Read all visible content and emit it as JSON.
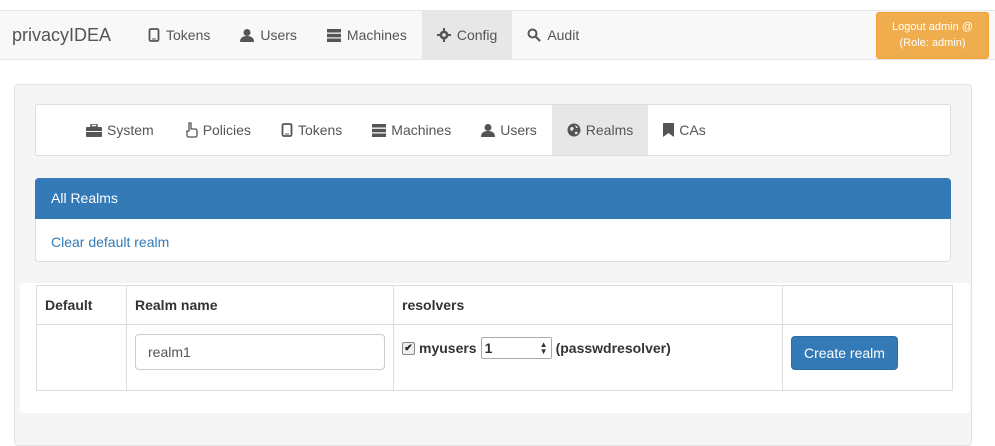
{
  "navbar": {
    "brand": "privacyIDEA",
    "items": [
      {
        "label": "Tokens",
        "icon": "phone-icon"
      },
      {
        "label": "Users",
        "icon": "user-icon"
      },
      {
        "label": "Machines",
        "icon": "server-icon"
      },
      {
        "label": "Config",
        "icon": "gear-icon",
        "active": true
      },
      {
        "label": "Audit",
        "icon": "search-icon"
      }
    ],
    "logout_line1": "Logout admin @",
    "logout_line2": "(Role: admin)"
  },
  "config_nav": {
    "items": [
      {
        "label": "System",
        "icon": "briefcase-icon"
      },
      {
        "label": "Policies",
        "icon": "hand-icon"
      },
      {
        "label": "Tokens",
        "icon": "phone-icon"
      },
      {
        "label": "Machines",
        "icon": "server-icon"
      },
      {
        "label": "Users",
        "icon": "user-icon"
      },
      {
        "label": "Realms",
        "icon": "globe-icon",
        "active": true
      },
      {
        "label": "CAs",
        "icon": "bookmark-icon"
      }
    ]
  },
  "realms_panel": {
    "heading": "All Realms",
    "clear_default": "Clear default realm"
  },
  "table": {
    "headers": [
      "Default",
      "Realm name",
      "resolvers"
    ],
    "row": {
      "realm_name_value": "realm1",
      "resolver_name": "myusers",
      "resolver_checked": true,
      "priority_value": "1",
      "resolver_type": "(passwdresolver)",
      "create_button": "Create realm"
    }
  },
  "colors": {
    "primary": "#337ab7",
    "warning": "#f0ad4e",
    "nav_bg": "#f8f8f8"
  }
}
